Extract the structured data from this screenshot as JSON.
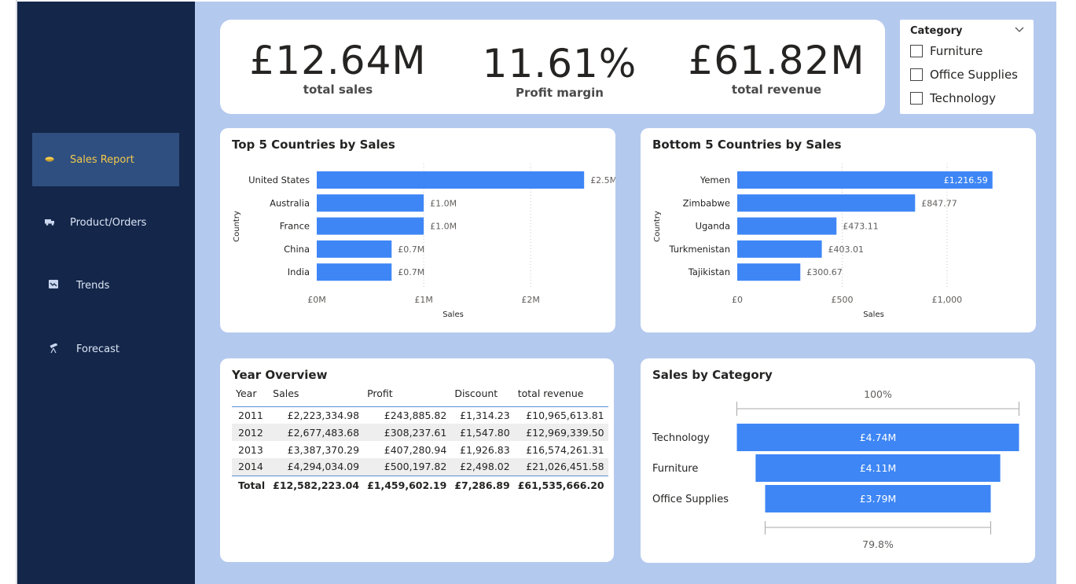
{
  "sidebar": {
    "items": [
      {
        "label": "Sales Report",
        "icon": "hand-coin-icon",
        "active": true
      },
      {
        "label": "Product/Orders",
        "icon": "truck-icon",
        "active": false
      },
      {
        "label": "Trends",
        "icon": "chart-icon",
        "active": false
      },
      {
        "label": "Forecast",
        "icon": "telescope-icon",
        "active": false
      }
    ]
  },
  "kpis": {
    "total_sales": {
      "value": "£12.64M",
      "label": "total sales"
    },
    "profit_margin": {
      "value": "11.61%",
      "label": "Profit margin"
    },
    "total_revenue": {
      "value": "£61.82M",
      "label": "total revenue"
    }
  },
  "slicer": {
    "title": "Category",
    "options": [
      "Furniture",
      "Office Supplies",
      "Technology"
    ]
  },
  "colors": {
    "bar": "#3e86f5",
    "sidebar": "#14264a",
    "active_nav": "#2f4f80",
    "active_text": "#f2c94c",
    "canvas": "#b4c9ee"
  },
  "chart_data": [
    {
      "type": "bar",
      "orientation": "horizontal",
      "title": "Top 5 Countries by Sales",
      "xlabel": "Sales",
      "ylabel": "Country",
      "categories": [
        "United States",
        "Australia",
        "France",
        "China",
        "India"
      ],
      "values": [
        2.5,
        1.0,
        1.0,
        0.7,
        0.7
      ],
      "value_labels": [
        "£2.5M",
        "£1.0M",
        "£1.0M",
        "£0.7M",
        "£0.7M"
      ],
      "xticks": [
        0,
        1,
        2
      ],
      "xtick_labels": [
        "£0M",
        "£1M",
        "£2M"
      ],
      "xlim": [
        0,
        2.55
      ],
      "label_inside": [
        false,
        false,
        false,
        false,
        false
      ]
    },
    {
      "type": "bar",
      "orientation": "horizontal",
      "title": "Bottom 5 Countries by Sales",
      "xlabel": "Sales",
      "ylabel": "Country",
      "categories": [
        "Yemen",
        "Zimbabwe",
        "Uganda",
        "Turkmenistan",
        "Tajikistan"
      ],
      "values": [
        1216.59,
        847.77,
        473.11,
        403.01,
        300.67
      ],
      "value_labels": [
        "£1,216.59",
        "£847.77",
        "£473.11",
        "£403.01",
        "£300.67"
      ],
      "xticks": [
        0,
        500,
        1000
      ],
      "xtick_labels": [
        "£0",
        "£500",
        "£1,000"
      ],
      "xlim": [
        0,
        1300
      ],
      "label_inside": [
        true,
        false,
        false,
        false,
        false
      ]
    },
    {
      "type": "funnel",
      "title": "Sales by Category",
      "categories": [
        "Technology",
        "Furniture",
        "Office Supplies"
      ],
      "values": [
        4.74,
        4.11,
        3.79
      ],
      "value_labels": [
        "£4.74M",
        "£4.11M",
        "£3.79M"
      ],
      "top_percent": "100%",
      "bottom_percent": "79.8%"
    }
  ],
  "table": {
    "title": "Year Overview",
    "columns": [
      "Year",
      "Sales",
      "Profit",
      "Discount",
      "total revenue"
    ],
    "rows": [
      [
        "2011",
        "£2,223,334.98",
        "£243,885.82",
        "£1,314.23",
        "£10,965,613.81"
      ],
      [
        "2012",
        "£2,677,483.68",
        "£308,237.61",
        "£1,547.80",
        "£12,969,339.50"
      ],
      [
        "2013",
        "£3,387,370.29",
        "£407,280.94",
        "£1,926.83",
        "£16,574,261.31"
      ],
      [
        "2014",
        "£4,294,034.09",
        "£500,197.82",
        "£2,498.02",
        "£21,026,451.58"
      ]
    ],
    "total": [
      "Total",
      "£12,582,223.04",
      "£1,459,602.19",
      "£7,286.89",
      "£61,535,666.20"
    ]
  }
}
